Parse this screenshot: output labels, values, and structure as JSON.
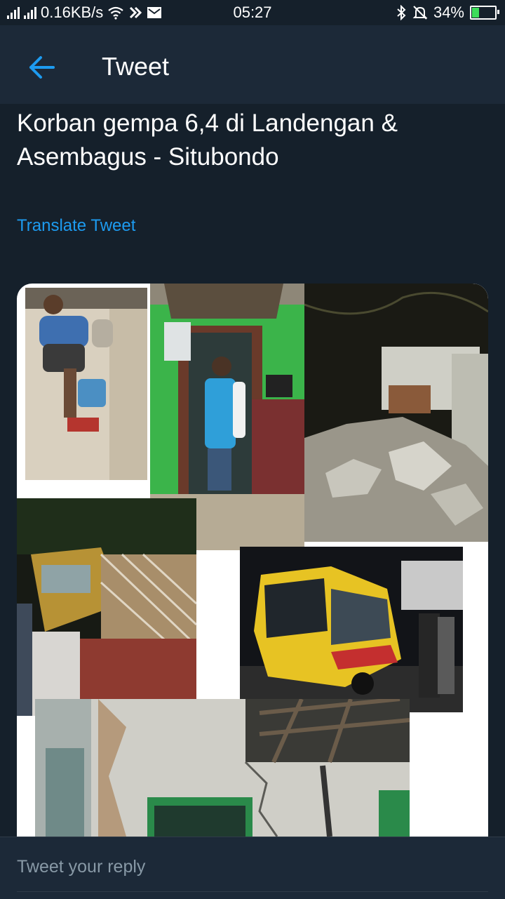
{
  "status_bar": {
    "net_speed": "0.16KB/s",
    "time": "05:27",
    "battery_percent": "34%",
    "battery_level": 0.34,
    "icons": [
      "signal-icon",
      "signal-icon",
      "wifi-icon",
      "notification-icon",
      "mail-icon",
      "bluetooth-icon",
      "silent-bell-icon",
      "battery-icon"
    ]
  },
  "appbar": {
    "title": "Tweet",
    "back_icon": "arrow-left-icon"
  },
  "tweet": {
    "text": "Korban gempa 6,4 di Landengan & Asembagus - Situbondo",
    "translate_label": "Translate Tweet"
  },
  "media": {
    "photos": [
      "injured-person-photo",
      "man-holding-baby-photo",
      "collapsed-wall-rubble-photo",
      "crashed-truck-photo",
      "damaged-bus-photo",
      "cracked-wall-photo"
    ]
  },
  "reply": {
    "placeholder": "Tweet your reply"
  },
  "colors": {
    "background": "#15202b",
    "bar": "#1c2938",
    "accent": "#1d9bf0",
    "muted": "#8899a6"
  }
}
